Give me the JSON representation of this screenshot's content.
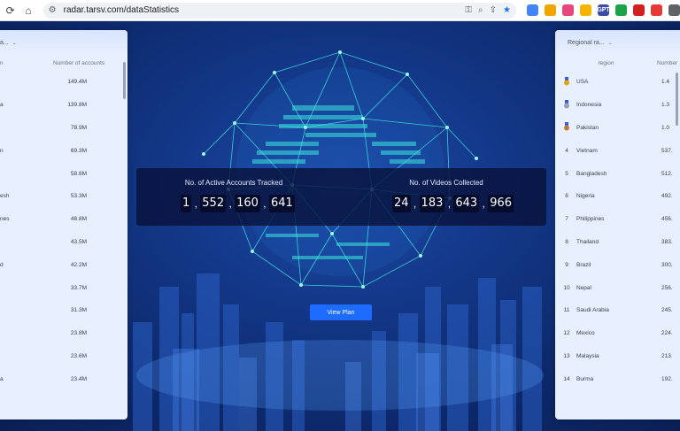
{
  "browser": {
    "url": "radar.tarsv.com/dataStatistics",
    "extensions": [
      {
        "icon": "translate-icon",
        "color": "#4285f4",
        "label": ""
      },
      {
        "icon": "chrome-ext-icon",
        "color": "#f0a500",
        "label": ""
      },
      {
        "icon": "pink-ext-icon",
        "color": "#e8457a",
        "label": ""
      },
      {
        "icon": "user-ext-icon",
        "color": "#f5b400",
        "label": ""
      },
      {
        "icon": "gpt-ext-icon",
        "color": "#3b4ba8",
        "label": "GPT"
      },
      {
        "icon": "green-ext-icon",
        "color": "#1ca34a",
        "label": ""
      },
      {
        "icon": "opera-ext-icon",
        "color": "#d21f1f",
        "label": ""
      },
      {
        "icon": "red-ext-icon",
        "color": "#e53935",
        "label": ""
      },
      {
        "icon": "puzzle-icon",
        "color": "#5f6368",
        "label": ""
      }
    ]
  },
  "left_panel": {
    "dropdown": "a...",
    "col_region": "n",
    "col_accounts": "Number of accounts",
    "rows": [
      {
        "region": "",
        "value": "149.4M"
      },
      {
        "region": "a",
        "value": "139.8M"
      },
      {
        "region": "",
        "value": "78.9M"
      },
      {
        "region": "n",
        "value": "69.3M"
      },
      {
        "region": "",
        "value": "58.6M"
      },
      {
        "region": "esh",
        "value": "53.3M"
      },
      {
        "region": "nes",
        "value": "48.8M"
      },
      {
        "region": "",
        "value": "43.5M"
      },
      {
        "region": "d",
        "value": "42.2M"
      },
      {
        "region": "",
        "value": "33.7M"
      },
      {
        "region": "",
        "value": "31.3M"
      },
      {
        "region": "",
        "value": "23.8M"
      },
      {
        "region": "",
        "value": "23.6M"
      },
      {
        "region": "a",
        "value": "23.4M"
      },
      {
        "region": "",
        "value": ""
      }
    ]
  },
  "right_panel": {
    "dropdown": "Regional ra...",
    "col_region": "region",
    "col_number": "Number",
    "rows": [
      {
        "rank": "",
        "medal": "gold",
        "region": "USA",
        "value": "1.4"
      },
      {
        "rank": "",
        "medal": "silver",
        "region": "Indonesia",
        "value": "1.3"
      },
      {
        "rank": "",
        "medal": "bronze",
        "region": "Pakistan",
        "value": "1.0"
      },
      {
        "rank": "4",
        "medal": "",
        "region": "Vietnam",
        "value": "537."
      },
      {
        "rank": "5",
        "medal": "",
        "region": "Bangladesh",
        "value": "512."
      },
      {
        "rank": "6",
        "medal": "",
        "region": "Nigeria",
        "value": "492."
      },
      {
        "rank": "7",
        "medal": "",
        "region": "Philippines",
        "value": "456."
      },
      {
        "rank": "8",
        "medal": "",
        "region": "Thailand",
        "value": "383."
      },
      {
        "rank": "9",
        "medal": "",
        "region": "Brazil",
        "value": "300."
      },
      {
        "rank": "10",
        "medal": "",
        "region": "Nepal",
        "value": "256."
      },
      {
        "rank": "11",
        "medal": "",
        "region": "Saudi Arabia",
        "value": "245."
      },
      {
        "rank": "12",
        "medal": "",
        "region": "Mexico",
        "value": "224."
      },
      {
        "rank": "13",
        "medal": "",
        "region": "Malaysia",
        "value": "213."
      },
      {
        "rank": "14",
        "medal": "",
        "region": "Burma",
        "value": "192."
      },
      {
        "rank": "",
        "medal": "",
        "region": "",
        "value": ""
      }
    ]
  },
  "counters": {
    "accounts_title": "No. of Active Accounts Tracked",
    "accounts_groups": [
      "1",
      "552",
      "160",
      "641"
    ],
    "videos_title": "No. of Videos Collected",
    "videos_groups": [
      "24",
      "183",
      "643",
      "966"
    ],
    "separator": ","
  },
  "view_plan_label": "View Plan",
  "colors": {
    "accent": "#1d6bff",
    "globe": "#3ee6e0",
    "background": "#0d2a6e"
  }
}
